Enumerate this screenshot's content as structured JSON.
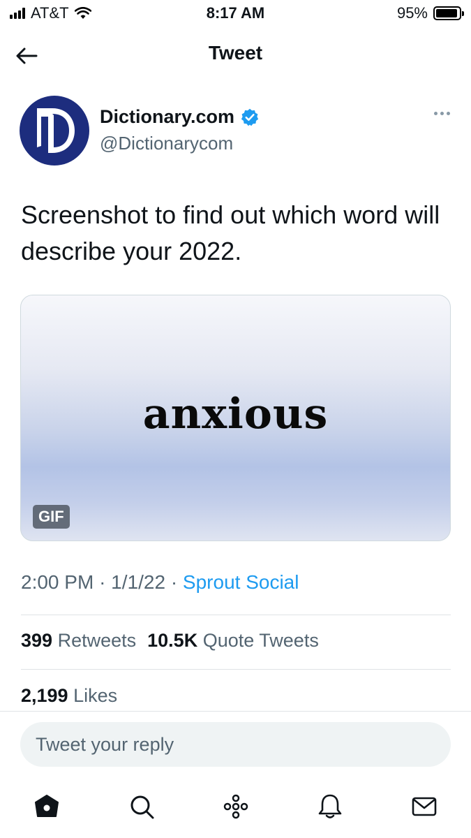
{
  "status_bar": {
    "carrier": "AT&T",
    "time": "8:17 AM",
    "battery": "95%",
    "battery_level": 0.95
  },
  "header": {
    "title": "Tweet",
    "back_icon": "arrow-left-icon"
  },
  "tweet": {
    "author": {
      "name": "Dictionary.com",
      "handle": "@Dictionarycom",
      "verified": true,
      "avatar_color": "#1d2d7e"
    },
    "text": "Screenshot to find out which word will describe your 2022.",
    "media": {
      "word": "anxious",
      "badge": "GIF"
    },
    "time": "2:00 PM",
    "date": "1/1/22",
    "separator": "·",
    "source": "Sprout Social",
    "retweets": {
      "count": "399",
      "label": "Retweets"
    },
    "quote_tweets": {
      "count": "10.5K",
      "label": "Quote Tweets"
    },
    "likes": {
      "count": "2,199",
      "label": "Likes"
    }
  },
  "reply": {
    "placeholder": "Tweet your reply"
  },
  "tab_bar": {
    "items": [
      "home-icon",
      "search-icon",
      "spaces-icon",
      "bell-icon",
      "mail-icon"
    ]
  },
  "colors": {
    "link": "#1d9bf0",
    "secondary_text": "#536471",
    "verified": "#1d9bf0"
  }
}
